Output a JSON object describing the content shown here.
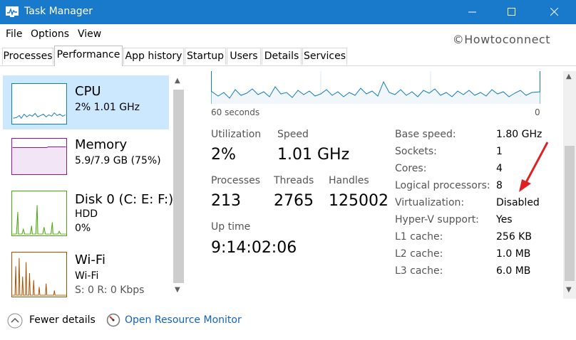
{
  "window": {
    "title": "Task Manager",
    "accent_color": "#1979ca",
    "app_icon": "task-manager-icon",
    "controls": [
      "minimize-icon",
      "maximize-icon",
      "close-icon"
    ]
  },
  "menu": [
    "File",
    "Options",
    "View"
  ],
  "watermark": "©Howtoconnect",
  "tabs": [
    "Processes",
    "Performance",
    "App history",
    "Startup",
    "Users",
    "Details",
    "Services"
  ],
  "active_tab": "Performance",
  "sidebar": [
    {
      "name": "CPU",
      "line1": "2%  1.01 GHz",
      "color": "#117dbb",
      "selected": true
    },
    {
      "name": "Memory",
      "line1": "5.9/7.9 GB (75%)",
      "color": "#8b12ae"
    },
    {
      "name": "Disk 0 (C: E: F:)",
      "line1": "HDD",
      "line2": "0%",
      "color": "#4da60c"
    },
    {
      "name": "Wi-Fi",
      "line1": "Wi-Fi",
      "line2": "S: 0  R: 0 Kbps",
      "color": "#a74f01"
    }
  ],
  "graph": {
    "left_label": "60 seconds",
    "right_label": "0",
    "color": "#117dbb"
  },
  "stats": {
    "utilization": {
      "label": "Utilization",
      "value": "2%"
    },
    "speed": {
      "label": "Speed",
      "value": "1.01 GHz"
    },
    "processes": {
      "label": "Processes",
      "value": "213"
    },
    "threads": {
      "label": "Threads",
      "value": "2765"
    },
    "handles": {
      "label": "Handles",
      "value": "125002"
    },
    "uptime": {
      "label": "Up time",
      "value": "9:14:02:06"
    }
  },
  "specs": [
    {
      "label": "Base speed:",
      "value": "1.80 GHz"
    },
    {
      "label": "Sockets:",
      "value": "1"
    },
    {
      "label": "Cores:",
      "value": "4"
    },
    {
      "label": "Logical processors:",
      "value": "8"
    },
    {
      "label": "Virtualization:",
      "value": "Disabled"
    },
    {
      "label": "Hyper-V support:",
      "value": "Yes"
    },
    {
      "label": "L1 cache:",
      "value": "256 KB"
    },
    {
      "label": "L2 cache:",
      "value": "1.0 MB"
    },
    {
      "label": "L3 cache:",
      "value": "6.0 MB"
    }
  ],
  "annotation_color": "#e02020",
  "footer": {
    "fewer_details": "Fewer details",
    "open_resource_monitor": "Open Resource Monitor"
  }
}
